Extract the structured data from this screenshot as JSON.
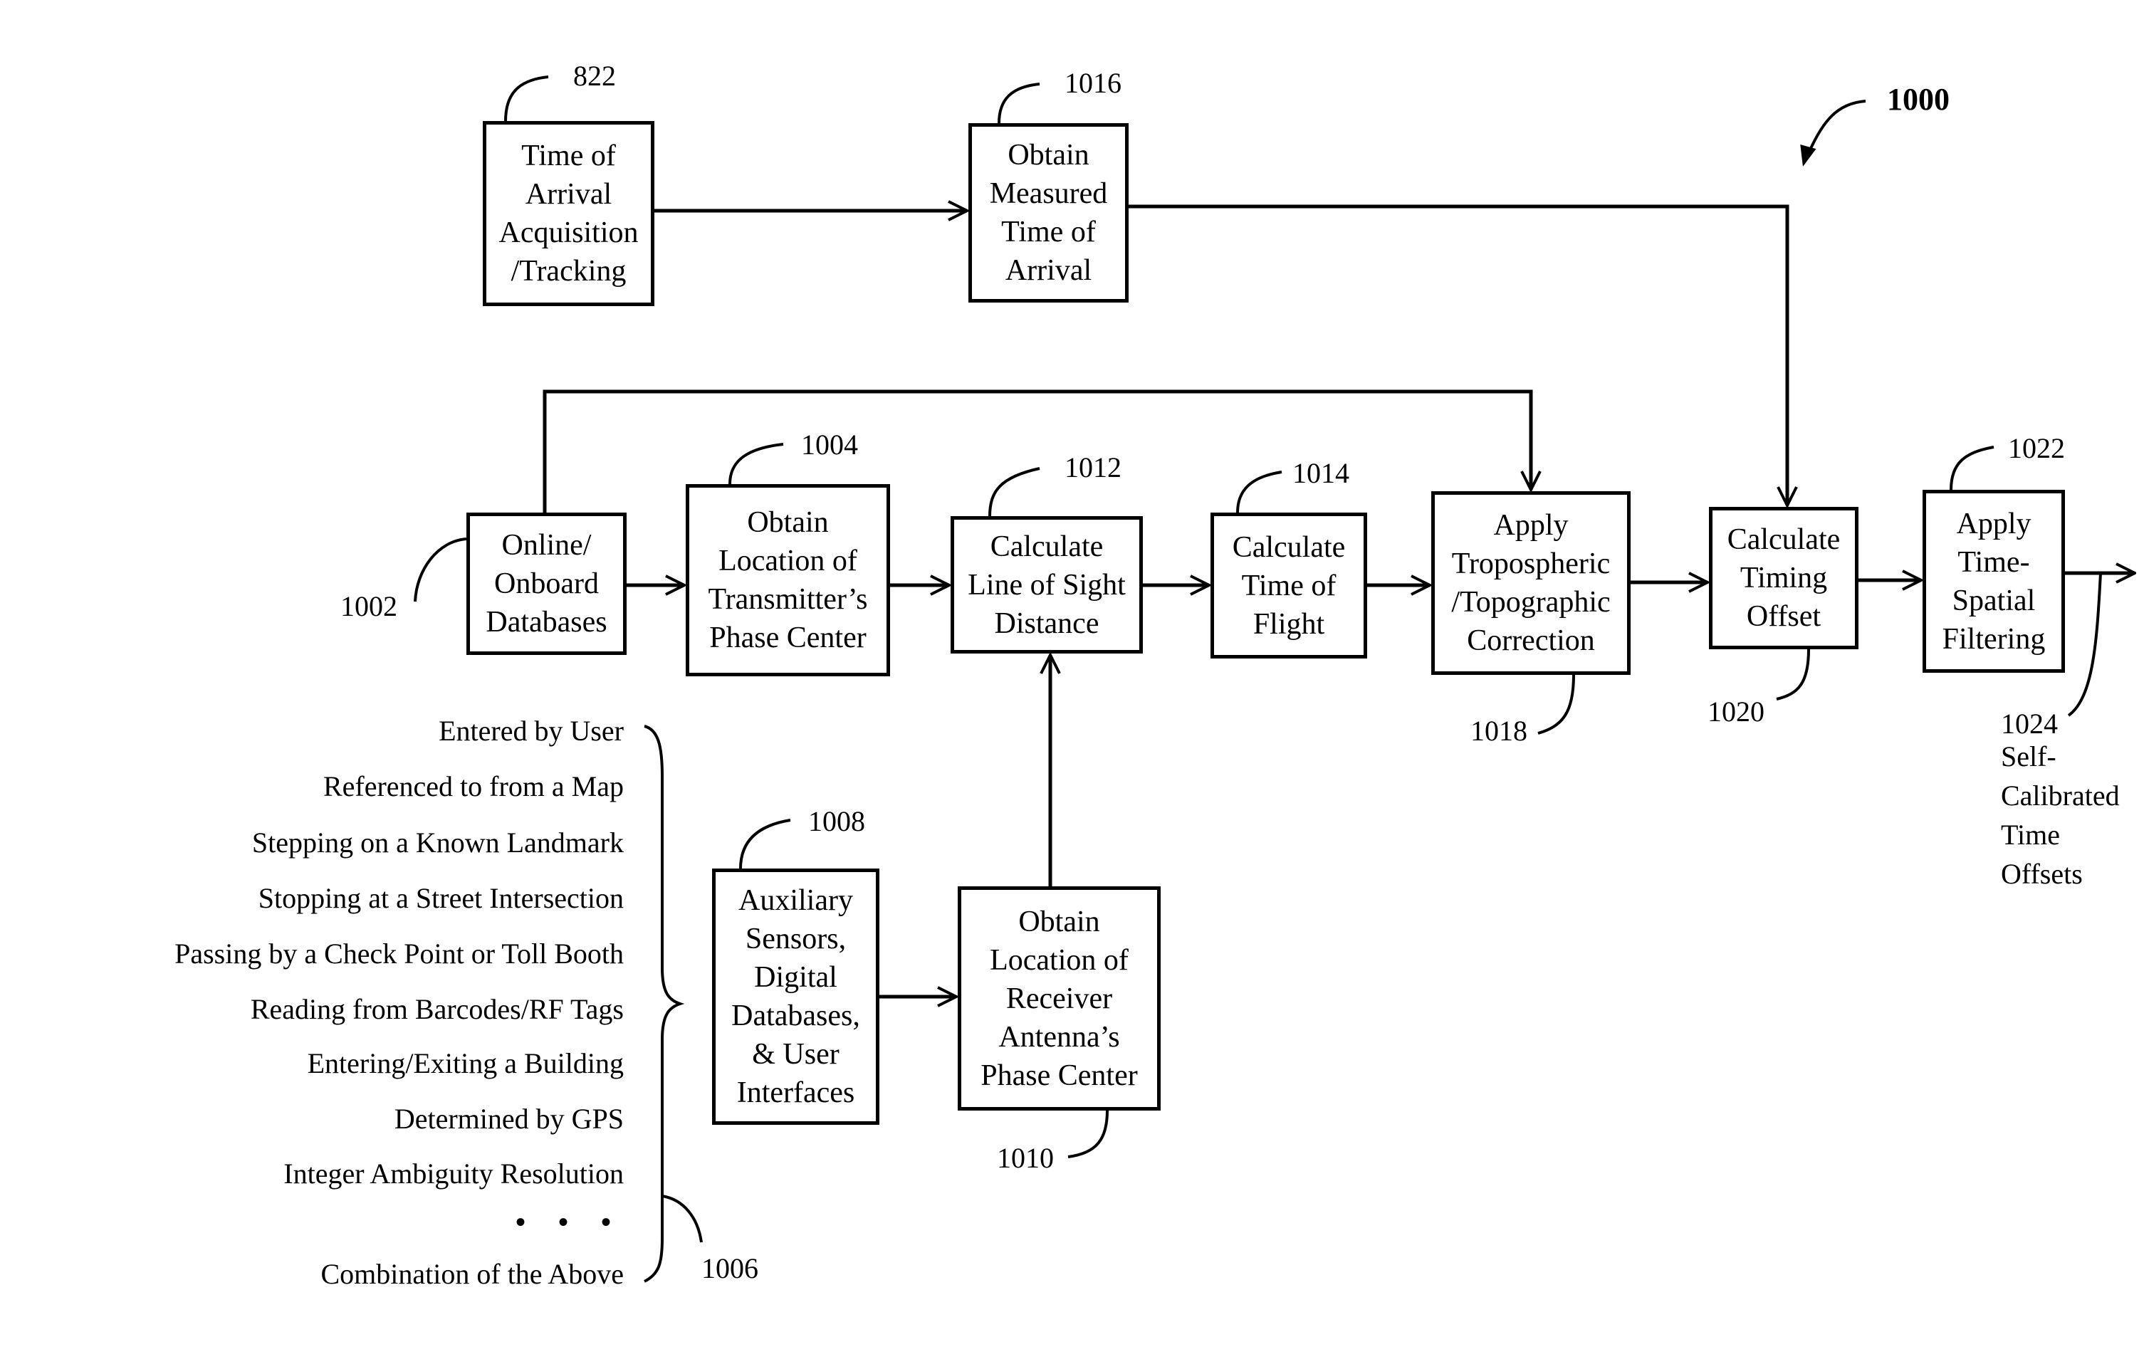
{
  "figure": {
    "number": "1000",
    "boxes": {
      "toa_acquisition": {
        "ref": "822",
        "label": "Time of\nArrival\nAcquisition\n/Tracking"
      },
      "measured_toa": {
        "ref": "1016",
        "label": "Obtain\nMeasured\nTime of\nArrival"
      },
      "databases": {
        "ref": "1002",
        "label": "Online/\nOnboard\nDatabases"
      },
      "transmitter_location": {
        "ref": "1004",
        "label": "Obtain\nLocation of\nTransmitter’s\nPhase Center"
      },
      "line_of_sight": {
        "ref": "1012",
        "label": "Calculate\nLine of Sight\nDistance"
      },
      "time_of_flight": {
        "ref": "1014",
        "label": "Calculate\nTime of\nFlight"
      },
      "tropo_correction": {
        "ref": "1018",
        "label": "Apply\nTropospheric\n/Topographic\nCorrection"
      },
      "timing_offset": {
        "ref": "1020",
        "label": "Calculate\nTiming\nOffset"
      },
      "time_spatial_filter": {
        "ref": "1022",
        "label": "Apply\nTime-\nSpatial\nFiltering"
      },
      "auxiliary_sensors": {
        "ref": "1008",
        "label": "Auxiliary\nSensors,\nDigital\nDatabases,\n& User\nInterfaces"
      },
      "receiver_location": {
        "ref": "1010",
        "label": "Obtain\nLocation of\nReceiver\nAntenna’s\nPhase Center"
      }
    },
    "output": {
      "ref": "1024",
      "label": "Self-\nCalibrated\nTime\nOffsets"
    },
    "receiver_sources": {
      "ref": "1006",
      "items": [
        "Entered by User",
        "Referenced to from a Map",
        "Stepping on a Known Landmark",
        "Stopping at a Street Intersection",
        "Passing by a Check Point or Toll Booth",
        "Reading from Barcodes/RF Tags",
        "Entering/Exiting a Building",
        "Determined by GPS",
        "Integer Ambiguity Resolution"
      ],
      "ellipsis": "• • •",
      "last_item": "Combination of the Above"
    }
  }
}
